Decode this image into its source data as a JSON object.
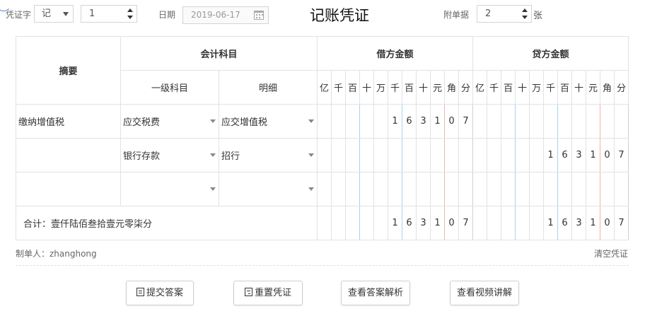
{
  "header": {
    "voucher_word_label": "凭证字",
    "voucher_word_value": "记",
    "voucher_number": "1",
    "date_label": "日期",
    "date_value": "2019-06-17",
    "title": "记账凭证",
    "attachments_label": "附单据",
    "attachments_count": "2",
    "attachments_unit": "张"
  },
  "table": {
    "summary_header": "摘要",
    "account_header": "会计科目",
    "level1_header": "一级科目",
    "detail_header": "明细",
    "debit_header": "借方金额",
    "credit_header": "贷方金额",
    "digit_headers": [
      "亿",
      "千",
      "百",
      "十",
      "万",
      "千",
      "百",
      "十",
      "元",
      "角",
      "分"
    ],
    "rows": [
      {
        "summary": "缴纳增值税",
        "level1": "应交税费",
        "detail": "应交增值税",
        "debit": [
          "",
          "",
          "",
          "",
          "",
          "1",
          "6",
          "3",
          "1",
          "0",
          "7"
        ],
        "credit": [
          "",
          "",
          "",
          "",
          "",
          "",
          "",
          "",
          "",
          "",
          ""
        ]
      },
      {
        "summary": "",
        "level1": "银行存款",
        "detail": "招行",
        "debit": [
          "",
          "",
          "",
          "",
          "",
          "",
          "",
          "",
          "",
          "",
          ""
        ],
        "credit": [
          "",
          "",
          "",
          "",
          "",
          "1",
          "6",
          "3",
          "1",
          "0",
          "7"
        ]
      },
      {
        "summary": "",
        "level1": "",
        "detail": "",
        "debit": [
          "",
          "",
          "",
          "",
          "",
          "",
          "",
          "",
          "",
          "",
          ""
        ],
        "credit": [
          "",
          "",
          "",
          "",
          "",
          "",
          "",
          "",
          "",
          "",
          ""
        ]
      }
    ],
    "total_label": "合计：壹仟陆佰叁拾壹元零柒分",
    "total_debit": [
      "",
      "",
      "",
      "",
      "",
      "1",
      "6",
      "3",
      "1",
      "0",
      "7"
    ],
    "total_credit": [
      "",
      "",
      "",
      "",
      "",
      "1",
      "6",
      "3",
      "1",
      "0",
      "7"
    ]
  },
  "footer": {
    "maker": "制单人：zhanghong",
    "clear": "清空凭证"
  },
  "buttons": {
    "submit": "提交答案",
    "reset": "重置凭证",
    "view_analysis": "查看答案解析",
    "view_video": "查看视频讲解"
  }
}
